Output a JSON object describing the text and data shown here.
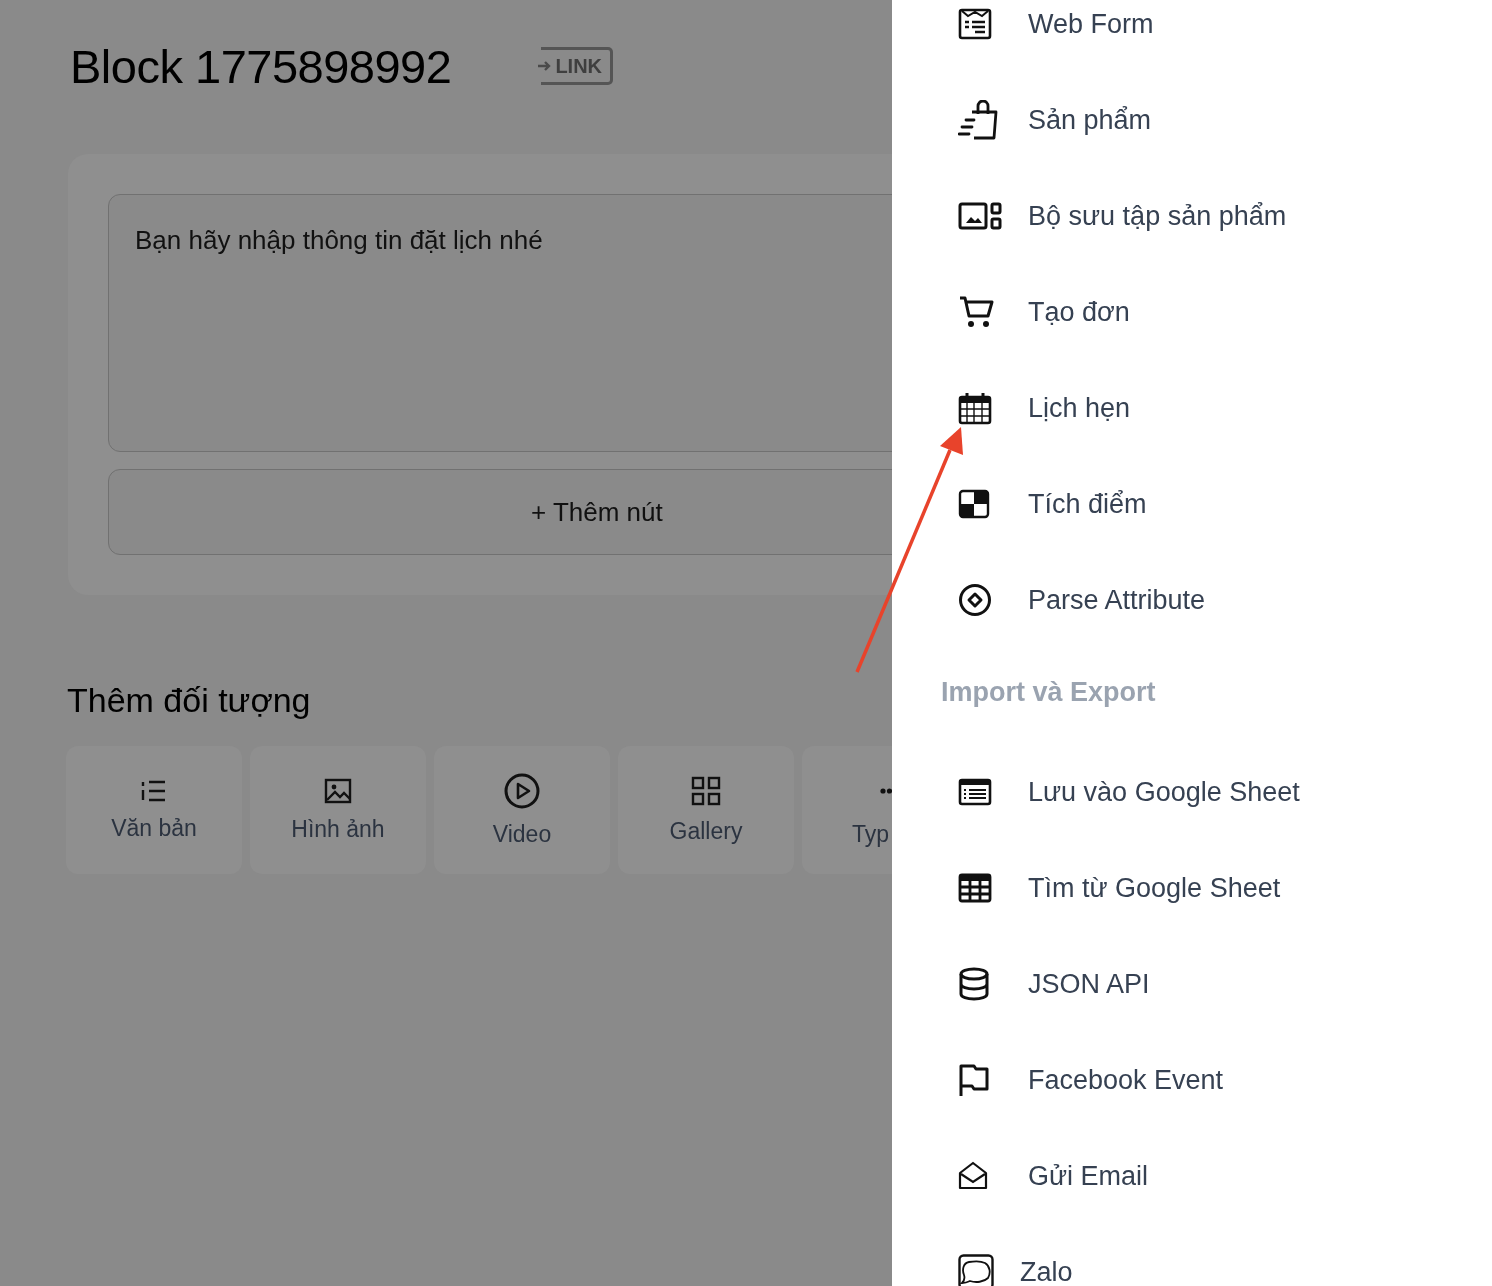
{
  "page": {
    "title": "Block 1775898992",
    "link_label": "LINK",
    "message": {
      "value": "Bạn hãy nhập thông tin đặt lịch nhé"
    },
    "add_button": "+ Thêm nút",
    "objects_title": "Thêm đối tượng",
    "objects": [
      {
        "label": "Văn bản"
      },
      {
        "label": "Hình ảnh"
      },
      {
        "label": "Video"
      },
      {
        "label": "Gallery"
      },
      {
        "label": "Typ"
      }
    ]
  },
  "drawer": {
    "sections": [
      {
        "items": [
          {
            "label": "Web Form"
          },
          {
            "label": "Sản phẩm"
          },
          {
            "label": "Bộ sưu tập sản phẩm"
          },
          {
            "label": "Tạo đơn"
          },
          {
            "label": "Lịch hẹn"
          },
          {
            "label": "Tích điểm"
          },
          {
            "label": "Parse Attribute"
          }
        ]
      },
      {
        "title": "Import và Export",
        "items": [
          {
            "label": "Lưu vào Google Sheet"
          },
          {
            "label": "Tìm từ Google Sheet"
          },
          {
            "label": "JSON API"
          },
          {
            "label": "Facebook Event"
          },
          {
            "label": "Gửi Email"
          },
          {
            "label": "Zalo"
          }
        ]
      }
    ]
  }
}
